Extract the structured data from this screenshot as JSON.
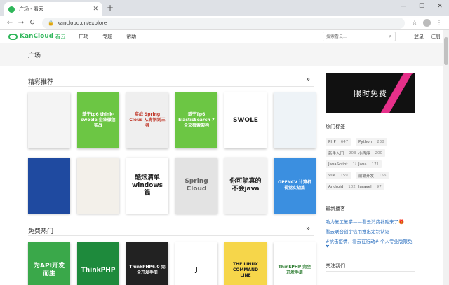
{
  "browser": {
    "tab_title": "广场 - 看云",
    "tab_close": "✕",
    "new_tab": "+",
    "url": "kancloud.cn/explore",
    "win_min": "—",
    "win_max": "☐",
    "win_close": "✕"
  },
  "nav": {
    "logo_text": "KanCloud",
    "logo_cn": "看云",
    "links": [
      "广场",
      "专题",
      "帮助"
    ],
    "search_placeholder": "搜索看云…",
    "login": "登录",
    "register": "注册"
  },
  "page": {
    "title": "广场"
  },
  "sections": {
    "featured": "精彩推荐",
    "free_hot": "免费热门",
    "more_symbol": "»"
  },
  "books_row1": [
    {
      "title": "",
      "bg": "#f4f4f4",
      "color": "#555"
    },
    {
      "title": "基于tp6 think-swoole 企业微信实战",
      "bg": "#6cc644",
      "color": "#fff"
    },
    {
      "title": "实战 Spring Cloud 从青铜到王者",
      "bg": "#efefef",
      "color": "#c0392b"
    },
    {
      "title": "基于Tp6 ElasticSearch 7 全文检索架构",
      "bg": "#6cc644",
      "color": "#fff"
    },
    {
      "title": "SWOLE",
      "bg": "#ffffff",
      "color": "#222"
    },
    {
      "title": "",
      "bg": "#eef3f7",
      "color": "#555"
    }
  ],
  "books_row2": [
    {
      "title": "",
      "bg": "#1f4aa0",
      "color": "#fff"
    },
    {
      "title": "",
      "bg": "#f3f0ea",
      "color": "#555"
    },
    {
      "title": "酷炫清单 windows篇",
      "bg": "#ffffff",
      "color": "#222"
    },
    {
      "title": "Spring Cloud",
      "bg": "#e3e3e3",
      "color": "#666"
    },
    {
      "title": "你可能真的不会java",
      "bg": "#f2f2f2",
      "color": "#222"
    },
    {
      "title": "OPENCV 计算机视觉实战篇",
      "bg": "#3b8fe0",
      "color": "#fff"
    }
  ],
  "books_row3": [
    {
      "title": "为API开发而生",
      "bg": "#3aa84a",
      "color": "#fff"
    },
    {
      "title": "ThinkPHP",
      "bg": "#1e8a3c",
      "color": "#fff"
    },
    {
      "title": "ThinkPHP6.0 完全开发手册",
      "bg": "#222222",
      "color": "#fff"
    },
    {
      "title": "J",
      "bg": "#ffffff",
      "color": "#111"
    },
    {
      "title": "THE LINUX COMMAND LINE",
      "bg": "#f6d64a",
      "color": "#222"
    },
    {
      "title": "ThinkPHP 完全开发手册",
      "bg": "#ffffff",
      "color": "#2e7d32"
    }
  ],
  "sidebar": {
    "promo": "限时免费",
    "tags_title": "热门标签",
    "tags": [
      {
        "name": "PHP",
        "count": "647"
      },
      {
        "name": "Python",
        "count": "238"
      },
      {
        "name": "新手入门",
        "count": "203"
      },
      {
        "name": "小程序",
        "count": "200"
      },
      {
        "name": "JavaScript",
        "count": "181"
      },
      {
        "name": "Java",
        "count": "171"
      },
      {
        "name": "Vue",
        "count": "159"
      },
      {
        "name": "前端开发",
        "count": "156"
      },
      {
        "name": "Android",
        "count": "102"
      },
      {
        "name": "laravel",
        "count": "97"
      }
    ],
    "blogs_title": "最新播客",
    "blogs": [
      "助力复工复学——看云消费补贴来了🎁",
      "看云联合创宇信用推出定制认证",
      "#抗击疫情，看云在行动# 个人专业版限免",
      "❤"
    ],
    "follow_title": "关注我们"
  }
}
